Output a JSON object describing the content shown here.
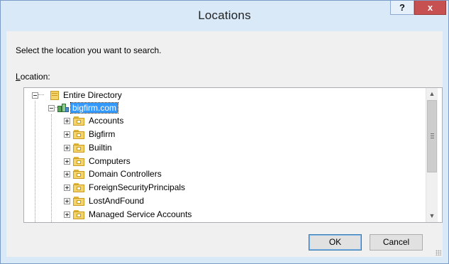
{
  "window": {
    "title": "Locations",
    "help_label": "?",
    "close_label": "x"
  },
  "dialog": {
    "prompt": "Select the location you want to search.",
    "location_label_accel": "L",
    "location_label_rest": "ocation:"
  },
  "tree": {
    "root": {
      "label": "Entire Directory",
      "icon": "directory-icon",
      "expanded": true
    },
    "domain": {
      "label": "bigfirm.com",
      "icon": "domain-icon",
      "expanded": true,
      "selected": true
    },
    "items": [
      {
        "label": "Accounts"
      },
      {
        "label": "Bigfirm"
      },
      {
        "label": "Builtin"
      },
      {
        "label": "Computers"
      },
      {
        "label": "Domain Controllers"
      },
      {
        "label": "ForeignSecurityPrincipals"
      },
      {
        "label": "LostAndFound"
      },
      {
        "label": "Managed Service Accounts"
      }
    ]
  },
  "scrollbar": {
    "up_arrow": "▲",
    "down_arrow": "▼"
  },
  "buttons": {
    "ok": "OK",
    "cancel": "Cancel"
  },
  "colors": {
    "selection": "#3399ff",
    "close_button": "#c75050",
    "title_bar": "#d9e9f8"
  }
}
